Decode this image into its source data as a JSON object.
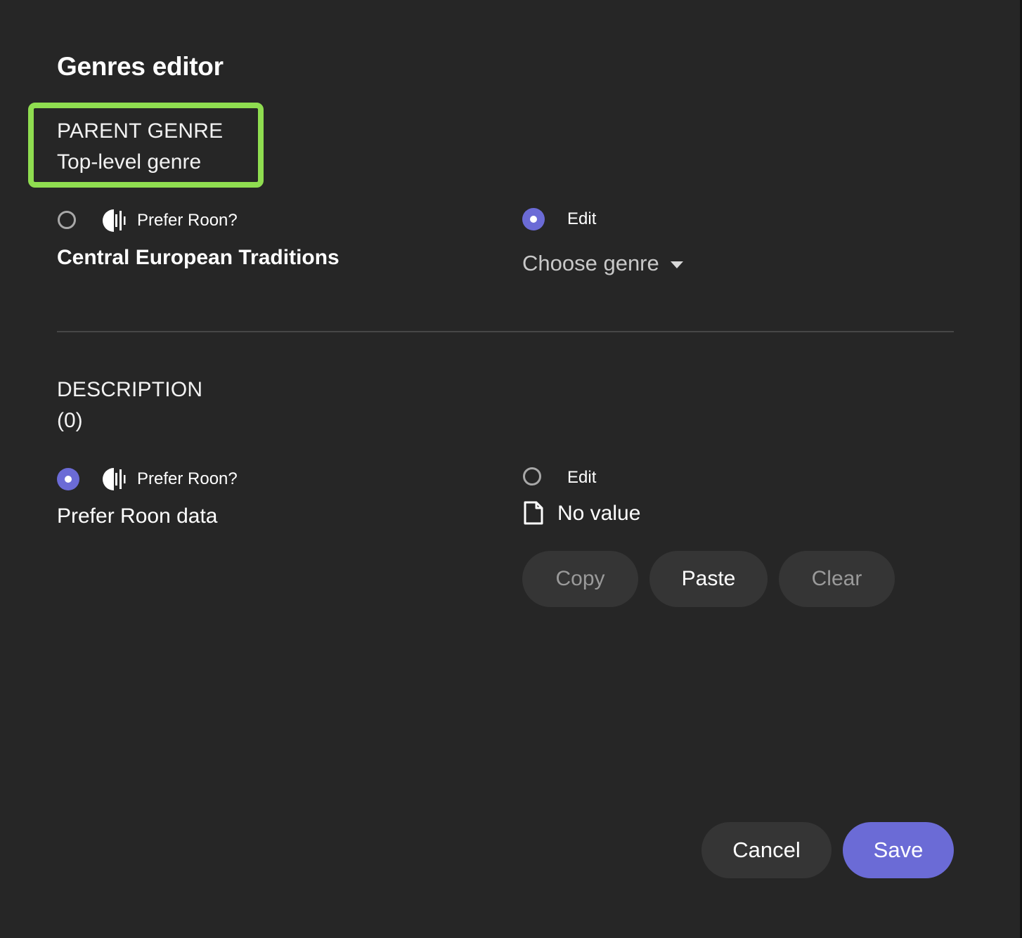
{
  "dialog": {
    "title": "Genres editor"
  },
  "parent_genre": {
    "label": "PARENT GENRE",
    "sublabel": "Top-level genre",
    "roon_option": {
      "label": "Prefer Roon?",
      "selected": false,
      "value": "Central European Traditions"
    },
    "edit_option": {
      "label": "Edit",
      "selected": true,
      "dropdown_label": "Choose genre"
    }
  },
  "description": {
    "label": "DESCRIPTION",
    "sublabel": "(0)",
    "roon_option": {
      "label": "Prefer Roon?",
      "selected": true,
      "value": "Prefer Roon data"
    },
    "edit_option": {
      "label": "Edit",
      "selected": false,
      "file_icon": "document-icon",
      "value": "No value"
    },
    "actions": {
      "copy": "Copy",
      "paste": "Paste",
      "clear": "Clear"
    }
  },
  "footer": {
    "cancel": "Cancel",
    "save": "Save"
  },
  "colors": {
    "background": "#262626",
    "accent": "#6b6bd6",
    "highlight": "#8fdd50",
    "button": "#353535"
  }
}
